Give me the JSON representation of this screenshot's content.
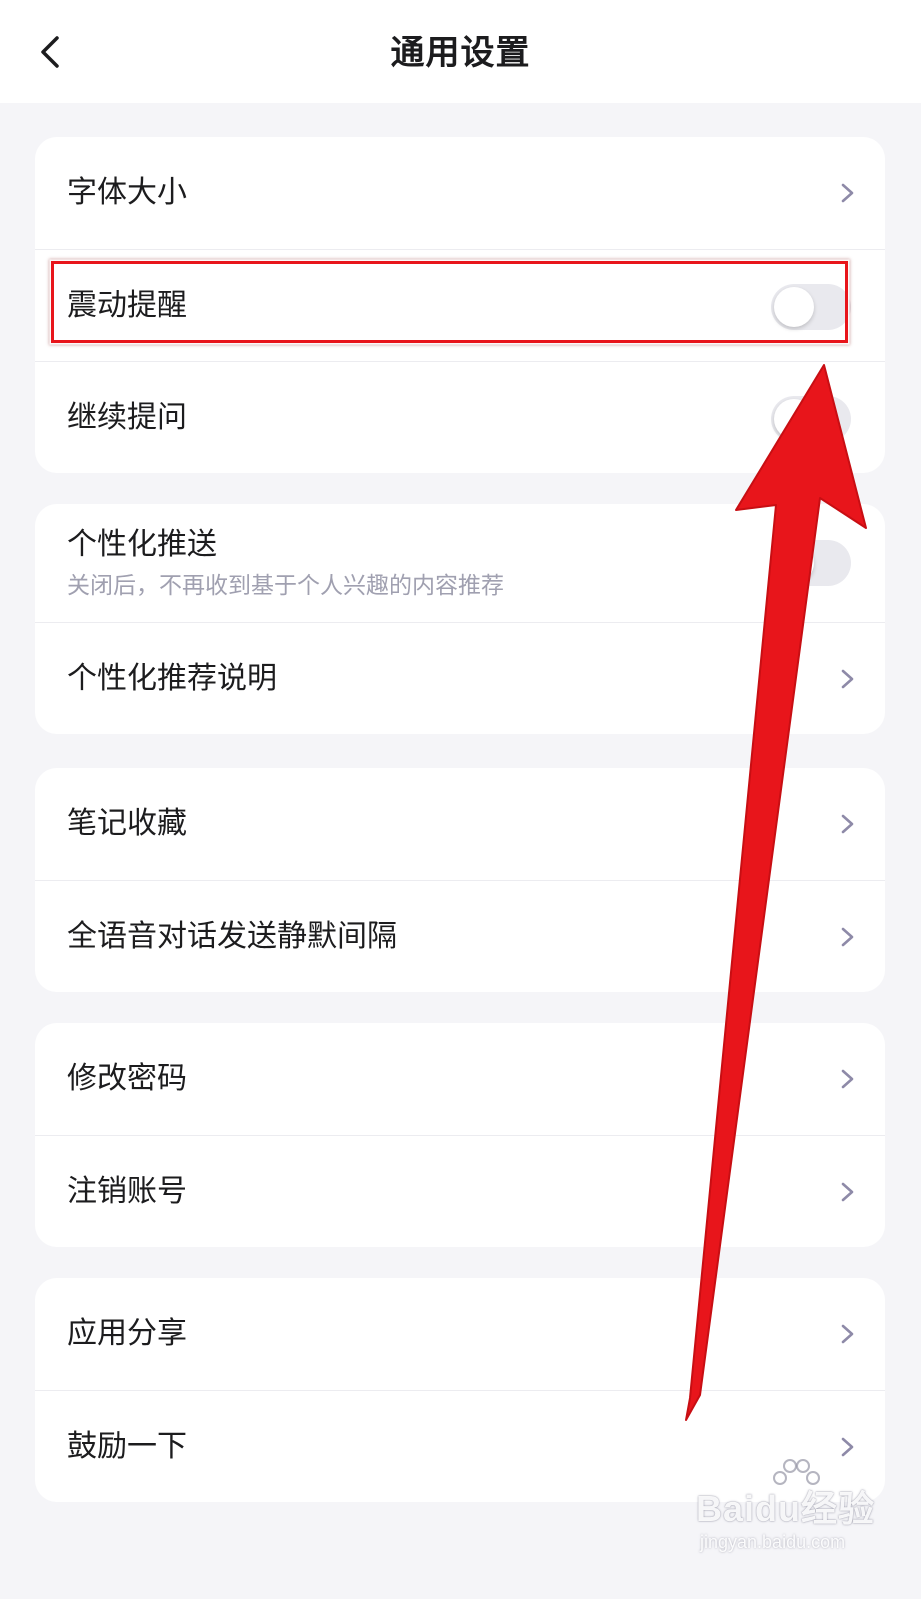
{
  "header": {
    "title": "通用设置"
  },
  "colors": {
    "background": "#f5f5f8",
    "card": "#ffffff",
    "text": "#1c1c1e",
    "subtext": "#a0a0b0",
    "chevron": "#8e8aa8",
    "toggle_off": "#e9e9ee",
    "annotation": "#e8151b"
  },
  "groups": [
    {
      "items": [
        {
          "label": "字体大小",
          "control": "chevron-right-icon"
        },
        {
          "label": "震动提醒",
          "control": "toggle",
          "enabled": false
        },
        {
          "label": "继续提问",
          "control": "toggle",
          "enabled": false
        }
      ]
    },
    {
      "items": [
        {
          "label": "个性化推送",
          "sublabel": "关闭后，不再收到基于个人兴趣的内容推荐",
          "control": "toggle",
          "enabled": false
        },
        {
          "label": "个性化推荐说明",
          "control": "chevron-right-icon"
        }
      ]
    },
    {
      "items": [
        {
          "label": "笔记收藏",
          "control": "chevron-right-icon"
        },
        {
          "label": "全语音对话发送静默间隔",
          "control": "chevron-right-icon"
        }
      ]
    },
    {
      "items": [
        {
          "label": "修改密码",
          "control": "chevron-right-icon"
        },
        {
          "label": "注销账号",
          "control": "chevron-right-icon"
        }
      ]
    },
    {
      "items": [
        {
          "label": "应用分享",
          "control": "chevron-right-icon"
        },
        {
          "label": "鼓励一下",
          "control": "chevron-right-icon"
        }
      ]
    }
  ],
  "watermark": {
    "brand": "Baidu经验",
    "url": "jingyan.baidu.com"
  }
}
